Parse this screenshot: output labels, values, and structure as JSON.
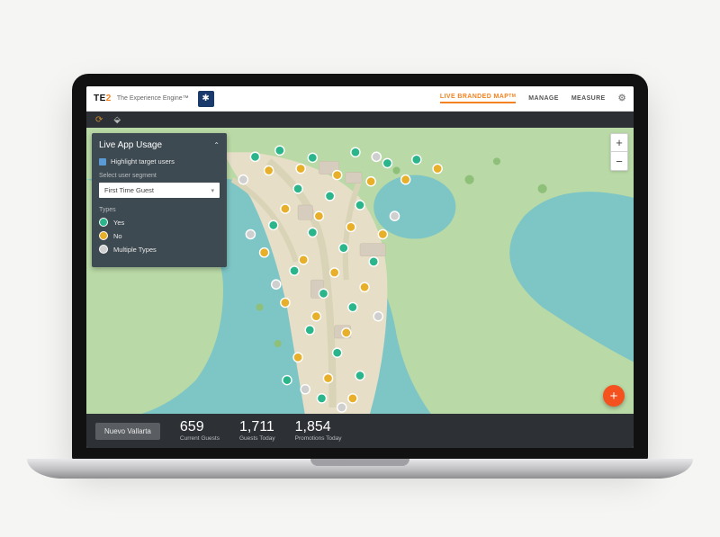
{
  "brand": {
    "logo_main": "TE",
    "logo_accent": "2",
    "logo_sub": "The Experience Engine™"
  },
  "header_nav": {
    "branded_map": "LIVE BRANDED MAP",
    "branded_map_badge": "TM",
    "manage": "MANAGE",
    "measure": "MEASURE"
  },
  "zoom": {
    "plus": "+",
    "minus": "−"
  },
  "panel": {
    "title": "Live App Usage",
    "checkbox_label": "Highlight target users",
    "segment_label": "Select user segment",
    "segment_value": "First Time Guest",
    "types_label": "Types",
    "legend": {
      "yes": "Yes",
      "no": "No",
      "mult": "Multiple Types"
    }
  },
  "fab": "+",
  "footer": {
    "location": "Nuevo Vallarta",
    "stat1_num": "659",
    "stat1_lbl": "Current Guests",
    "stat2_num": "1,711",
    "stat2_lbl": "Guests Today",
    "stat3_num": "1,854",
    "stat3_lbl": "Promotions Today"
  }
}
